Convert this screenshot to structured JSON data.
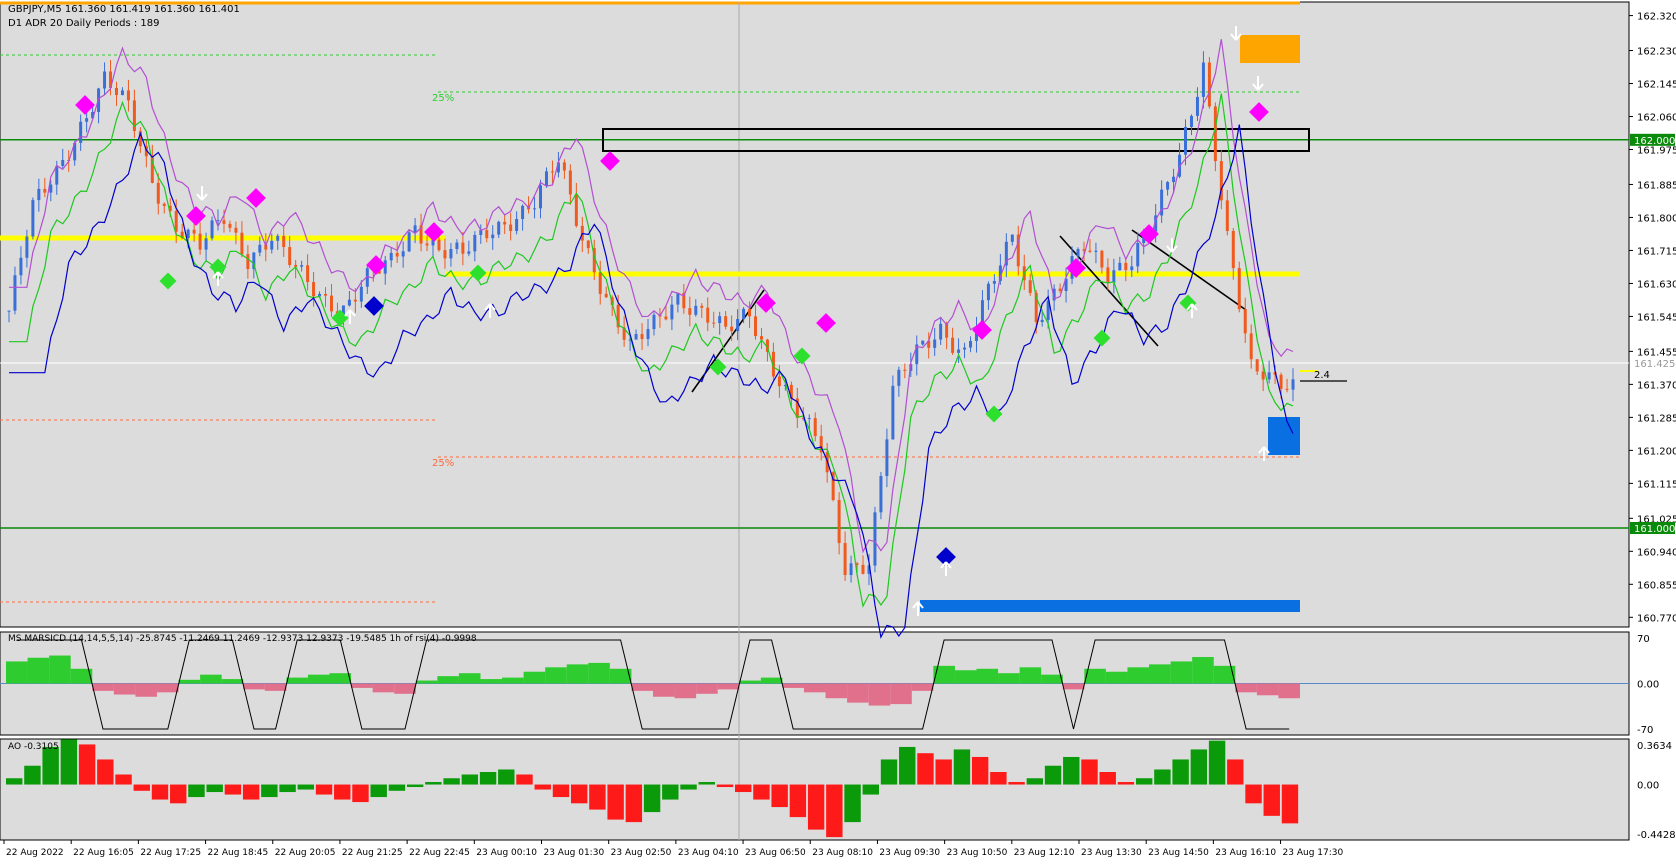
{
  "header": {
    "symbol_line": "GBPJPY,M5  161.360 161.419 161.360 161.401",
    "adr_line": "D1 ADR 20 Daily Periods : 189"
  },
  "main_chart": {
    "price_ticks": [
      "162.320",
      "162.230",
      "162.145",
      "162.060",
      "161.975",
      "161.885",
      "161.800",
      "161.715",
      "161.630",
      "161.545",
      "161.455",
      "161.370",
      "161.285",
      "161.200",
      "161.115",
      "161.025",
      "160.940",
      "160.855",
      "160.770"
    ],
    "price_range": [
      160.745,
      162.355
    ],
    "level_labels": [
      {
        "text": "162.000",
        "price": 162.0,
        "bg": "#0a8a0a",
        "color": "#ffffff"
      },
      {
        "text": "161.000",
        "price": 161.0,
        "bg": "#0a8a0a",
        "color": "#ffffff"
      },
      {
        "text": "161.425",
        "price": 161.425,
        "bg": "#ffffff",
        "color": "#999999"
      }
    ],
    "pct_labels": [
      {
        "text": "25%",
        "price": 162.13,
        "color": "#2ecc2e"
      },
      {
        "text": "25%",
        "price": 161.19,
        "color": "#ff6a3d"
      }
    ],
    "right_label": "2.4"
  },
  "macd_panel": {
    "title": "MS MARSICD (14,14,5,5,14) -25.8745 -11.2469 11.2469 -12.9373 12.9373 -19.5485  1h of rsi(4) -0.9998",
    "ticks": [
      "70",
      "0.00",
      "-70"
    ]
  },
  "ao_panel": {
    "title": "AO -0.3105",
    "ticks": [
      "0.3634",
      "0.00",
      "-0.4428"
    ]
  },
  "time_axis": [
    "22 Aug 2022",
    "22 Aug 16:05",
    "22 Aug 17:25",
    "22 Aug 18:45",
    "22 Aug 20:05",
    "22 Aug 21:25",
    "22 Aug 22:45",
    "23 Aug 00:10",
    "23 Aug 01:30",
    "23 Aug 02:50",
    "23 Aug 04:10",
    "23 Aug 06:50",
    "23 Aug 08:10",
    "23 Aug 09:30",
    "23 Aug 10:50",
    "23 Aug 12:10",
    "23 Aug 13:30",
    "23 Aug 14:50",
    "23 Aug 16:10",
    "23 Aug 17:30"
  ],
  "colors": {
    "bull": "#3a6fd8",
    "bear": "#f05a1e",
    "green": "#1ec81e",
    "purple": "#b24fd2",
    "blue": "#0000cc",
    "yellow": "#ffff00",
    "hist_pos": "#2ecc2e",
    "hist_neg": "#e0708c",
    "ao_up": "#0a9a0a",
    "ao_down": "#ff1a1a",
    "magenta": "#ff00ff",
    "orange": "#ffa500",
    "boxblue": "#0a6fe0",
    "level_green": "#0a8a0a"
  },
  "chart_data": [
    {
      "type": "line",
      "title": "GBPJPY,M5",
      "x_labels": [
        "22 Aug 2022",
        "22 Aug 16:05",
        "22 Aug 17:25",
        "22 Aug 18:45",
        "22 Aug 20:05",
        "22 Aug 21:25",
        "22 Aug 22:45",
        "23 Aug 00:10",
        "23 Aug 01:30",
        "23 Aug 02:50",
        "23 Aug 04:10",
        "23 Aug 06:50",
        "23 Aug 08:10",
        "23 Aug 09:30",
        "23 Aug 10:50",
        "23 Aug 12:10",
        "23 Aug 13:30",
        "23 Aug 14:50",
        "23 Aug 16:10",
        "23 Aug 17:30"
      ],
      "series": [
        {
          "values": [
            161.56,
            161.82,
            161.92,
            162.04,
            162.15,
            162.08,
            161.9,
            161.78,
            161.72,
            161.8,
            161.7,
            161.75,
            161.66,
            161.6,
            161.57,
            161.64,
            161.68,
            161.78,
            161.72,
            161.7,
            161.76,
            161.8,
            161.84,
            161.94,
            161.75,
            161.6,
            161.46,
            161.52,
            161.6,
            161.56,
            161.5,
            161.55,
            161.42,
            161.3,
            161.2,
            160.9,
            160.92,
            161.35,
            161.45,
            161.52,
            161.45,
            161.6,
            161.75,
            161.55,
            161.62,
            161.72,
            161.66,
            161.7,
            161.8,
            161.95,
            162.2,
            161.75,
            161.4,
            161.38
          ]
        }
      ],
      "ylim": [
        160.745,
        162.355
      ],
      "levels": [
        162.0,
        161.0,
        161.425
      ]
    },
    {
      "type": "bar",
      "title": "MS MARSICD",
      "ylim": [
        -70,
        70
      ],
      "values": [
        30,
        35,
        38,
        20,
        -10,
        -15,
        -18,
        -12,
        5,
        12,
        6,
        -8,
        -10,
        8,
        12,
        14,
        -6,
        -12,
        -14,
        4,
        10,
        14,
        6,
        8,
        16,
        22,
        26,
        28,
        20,
        -10,
        -18,
        -20,
        -14,
        -8,
        4,
        8,
        -6,
        -12,
        -20,
        -26,
        -30,
        -28,
        -10,
        24,
        18,
        20,
        14,
        22,
        12,
        -8,
        20,
        16,
        22,
        26,
        30,
        36,
        24,
        -12,
        -16,
        -20
      ]
    },
    {
      "type": "bar",
      "title": "AO -0.3105",
      "ylim": [
        -0.4428,
        0.3634
      ],
      "values": [
        0.05,
        0.15,
        0.3,
        0.36,
        0.32,
        0.2,
        0.08,
        -0.05,
        -0.12,
        -0.15,
        -0.1,
        -0.06,
        -0.08,
        -0.12,
        -0.1,
        -0.06,
        -0.04,
        -0.08,
        -0.12,
        -0.14,
        -0.1,
        -0.05,
        -0.02,
        0.02,
        0.05,
        0.08,
        0.1,
        0.12,
        0.08,
        -0.04,
        -0.1,
        -0.15,
        -0.2,
        -0.28,
        -0.3,
        -0.22,
        -0.12,
        -0.04,
        0.02,
        -0.02,
        -0.06,
        -0.12,
        -0.18,
        -0.26,
        -0.36,
        -0.42,
        -0.3,
        -0.08,
        0.2,
        0.3,
        0.25,
        0.2,
        0.28,
        0.22,
        0.1,
        0.02,
        0.05,
        0.15,
        0.22,
        0.2,
        0.1,
        0.02,
        0.05,
        0.12,
        0.2,
        0.28,
        0.35,
        0.2,
        -0.15,
        -0.25,
        -0.31
      ]
    }
  ]
}
